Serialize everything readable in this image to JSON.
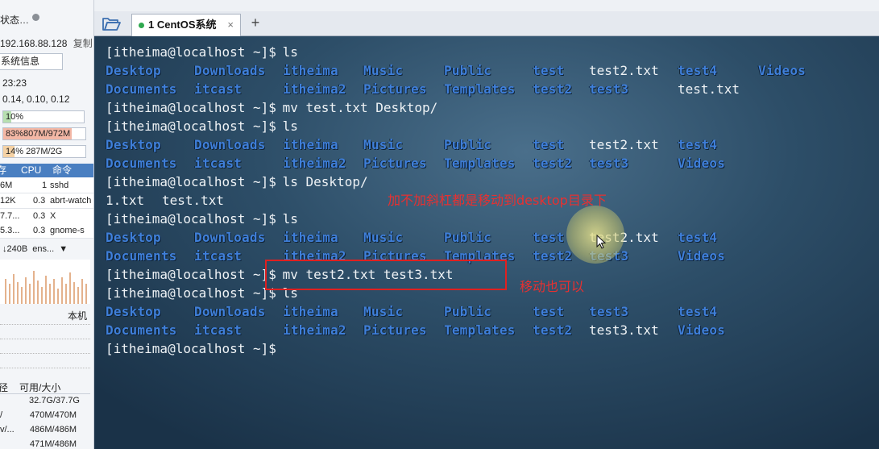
{
  "side": {
    "title": "状态",
    "ip": "192.168.88.128",
    "copy": "复制",
    "sysinfo": "系统信息",
    "time": "23:23",
    "load": "0.14, 0.10, 0.12",
    "cpu_label": "10%",
    "cpu_fill": 0.1,
    "mem_label": "83%807M/972M",
    "mem_fill": 0.83,
    "swap_label": "14%   287M/2G",
    "swap_fill": 0.14,
    "proc_headers": [
      "存",
      "CPU",
      "命令"
    ],
    "procs": [
      {
        "mem": "6M",
        "cpu": "1",
        "cmd": "sshd"
      },
      {
        "mem": "12K",
        "cpu": "0.3",
        "cmd": "abrt-watch"
      },
      {
        "mem": "7.7...",
        "cpu": "0.3",
        "cmd": "X"
      },
      {
        "mem": "5.3...",
        "cpu": "0.3",
        "cmd": "gnome-s"
      }
    ],
    "net_rate": "↓240B",
    "net_iface": "ens...",
    "local": "本机",
    "disk_headers": [
      "径",
      "可用/大小"
    ],
    "disks": [
      {
        "path": "",
        "size": "32.7G/37.7G"
      },
      {
        "path": "/",
        "size": "470M/470M"
      },
      {
        "path": "v/...",
        "size": "486M/486M"
      },
      {
        "path": "",
        "size": "471M/486M"
      }
    ],
    "colors": {
      "cpu": "#b7dfb0",
      "mem": "#f3b7a5",
      "swap": "#f5d2a5"
    }
  },
  "tabs": {
    "active_label": "1 CentOS系统",
    "close": "×",
    "add": "+",
    "folder_icon": "folder-open-icon"
  },
  "terminal": {
    "prompt": "[itheima@localhost ~]$",
    "lines": [
      {
        "kind": "cmd",
        "cmd": " ls"
      },
      {
        "kind": "out",
        "items": [
          {
            "t": "Desktop",
            "c": "dir"
          },
          {
            "t": "Downloads",
            "c": "dir"
          },
          {
            "t": "itheima",
            "c": "dir"
          },
          {
            "t": "Music",
            "c": "dir"
          },
          {
            "t": "Public",
            "c": "dir"
          },
          {
            "t": "test",
            "c": "dir"
          },
          {
            "t": "test2.txt",
            "c": "file"
          },
          {
            "t": "test4",
            "c": "dir"
          },
          {
            "t": "Videos",
            "c": "dir"
          }
        ]
      },
      {
        "kind": "out",
        "items": [
          {
            "t": "Documents",
            "c": "dir"
          },
          {
            "t": "itcast",
            "c": "dir"
          },
          {
            "t": "itheima2",
            "c": "dir"
          },
          {
            "t": "Pictures",
            "c": "dir"
          },
          {
            "t": "Templates",
            "c": "dir"
          },
          {
            "t": "test2",
            "c": "dir"
          },
          {
            "t": "test3",
            "c": "dir"
          },
          {
            "t": "test.txt",
            "c": "file"
          }
        ]
      },
      {
        "kind": "cmd",
        "cmd": " mv test.txt Desktop/"
      },
      {
        "kind": "cmd",
        "cmd": " ls"
      },
      {
        "kind": "out",
        "items": [
          {
            "t": "Desktop",
            "c": "dir"
          },
          {
            "t": "Downloads",
            "c": "dir"
          },
          {
            "t": "itheima",
            "c": "dir"
          },
          {
            "t": "Music",
            "c": "dir"
          },
          {
            "t": "Public",
            "c": "dir"
          },
          {
            "t": "test",
            "c": "dir"
          },
          {
            "t": "test2.txt",
            "c": "file"
          },
          {
            "t": "test4",
            "c": "dir"
          }
        ]
      },
      {
        "kind": "out",
        "items": [
          {
            "t": "Documents",
            "c": "dir"
          },
          {
            "t": "itcast",
            "c": "dir"
          },
          {
            "t": "itheima2",
            "c": "dir"
          },
          {
            "t": "Pictures",
            "c": "dir"
          },
          {
            "t": "Templates",
            "c": "dir"
          },
          {
            "t": "test2",
            "c": "dir"
          },
          {
            "t": "test3",
            "c": "dir"
          },
          {
            "t": "Videos",
            "c": "dir"
          }
        ]
      },
      {
        "kind": "cmd",
        "cmd": " ls Desktop/"
      },
      {
        "kind": "out",
        "items": [
          {
            "t": "1.txt",
            "c": "file"
          },
          {
            "t": "test.txt",
            "c": "file"
          }
        ]
      },
      {
        "kind": "cmd",
        "cmd": " ls"
      },
      {
        "kind": "out",
        "items": [
          {
            "t": "Desktop",
            "c": "dir"
          },
          {
            "t": "Downloads",
            "c": "dir"
          },
          {
            "t": "itheima",
            "c": "dir"
          },
          {
            "t": "Music",
            "c": "dir"
          },
          {
            "t": "Public",
            "c": "dir"
          },
          {
            "t": "test",
            "c": "dir"
          },
          {
            "t": "test2.txt",
            "c": "file"
          },
          {
            "t": "test4",
            "c": "dir"
          }
        ]
      },
      {
        "kind": "out",
        "items": [
          {
            "t": "Documents",
            "c": "dir"
          },
          {
            "t": "itcast",
            "c": "dir"
          },
          {
            "t": "itheima2",
            "c": "dir"
          },
          {
            "t": "Pictures",
            "c": "dir"
          },
          {
            "t": "Templates",
            "c": "dir"
          },
          {
            "t": "test2",
            "c": "dir"
          },
          {
            "t": "test3",
            "c": "dir"
          },
          {
            "t": "Videos",
            "c": "dir"
          }
        ]
      },
      {
        "kind": "cmd",
        "cmd": " mv test2.txt test3.txt"
      },
      {
        "kind": "cmd",
        "cmd": " ls"
      },
      {
        "kind": "out",
        "items": [
          {
            "t": "Desktop",
            "c": "dir"
          },
          {
            "t": "Downloads",
            "c": "dir"
          },
          {
            "t": "itheima",
            "c": "dir"
          },
          {
            "t": "Music",
            "c": "dir"
          },
          {
            "t": "Public",
            "c": "dir"
          },
          {
            "t": "test",
            "c": "dir"
          },
          {
            "t": "test3",
            "c": "dir"
          },
          {
            "t": "test4",
            "c": "dir"
          }
        ]
      },
      {
        "kind": "out",
        "items": [
          {
            "t": "Documents",
            "c": "dir"
          },
          {
            "t": "itcast",
            "c": "dir"
          },
          {
            "t": "itheima2",
            "c": "dir"
          },
          {
            "t": "Pictures",
            "c": "dir"
          },
          {
            "t": "Templates",
            "c": "dir"
          },
          {
            "t": "test2",
            "c": "dir"
          },
          {
            "t": "test3.txt",
            "c": "file"
          },
          {
            "t": "Videos",
            "c": "dir"
          }
        ]
      },
      {
        "kind": "cmd",
        "cmd": ""
      }
    ],
    "annotations": {
      "note1": "加不加斜杠都是移动到desktop目录下",
      "note2": "移动也可以"
    },
    "colors": {
      "dir": "#3f7fd9",
      "text": "#eef2f5",
      "annotation": "#e83030"
    }
  }
}
